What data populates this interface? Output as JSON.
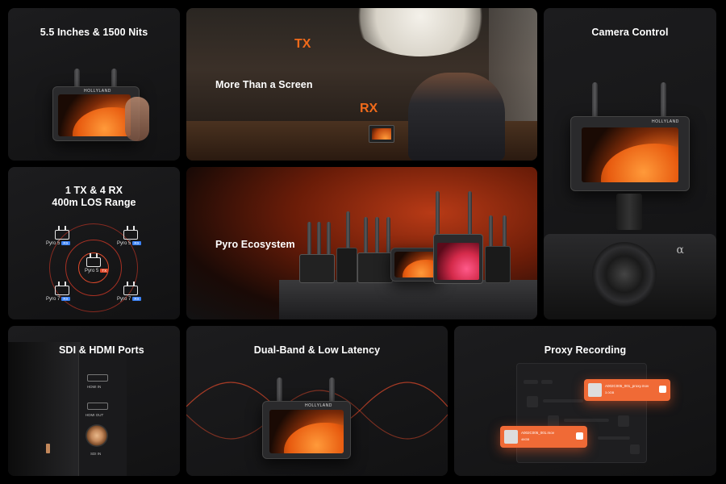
{
  "cards": {
    "brightness": {
      "title": "5.5 Inches & 1500 Nits"
    },
    "screen": {
      "title": "More Than a Screen",
      "tx_label": "TX",
      "rx_label": "RX"
    },
    "camera": {
      "title": "Camera Control",
      "lens_mark": "α"
    },
    "range": {
      "title_line1": "1 TX & 4 RX",
      "title_line2": "400m LOS Range",
      "nodes": [
        {
          "label": "Pyro 5",
          "tag": "RX"
        },
        {
          "label": "Pyro 5",
          "tag": "RX"
        },
        {
          "label": "Pyro 5",
          "tag": "TX"
        },
        {
          "label": "Pyro 7",
          "tag": "RX"
        },
        {
          "label": "Pyro 7",
          "tag": "RX"
        }
      ]
    },
    "ecosystem": {
      "title": "Pyro Ecosystem"
    },
    "ports": {
      "title": "SDI & HDMI Ports",
      "hdmi_in": "HDMI IN",
      "hdmi_out": "HDMI OUT",
      "sdi_in": "SDI IN"
    },
    "latency": {
      "title": "Dual-Band & Low Latency"
    },
    "proxy": {
      "title": "Proxy Recording",
      "file1": {
        "name": "A002C005_001_proxy.mov",
        "size": "3.0GB"
      },
      "file2": {
        "name": "A002C005_001.mov",
        "size": "46GB"
      }
    }
  },
  "brand": "HOLLYLAND",
  "colors": {
    "accent": "#f06a1a",
    "rx_tag": "#3b82f6",
    "tx_tag": "#e24a2b"
  }
}
